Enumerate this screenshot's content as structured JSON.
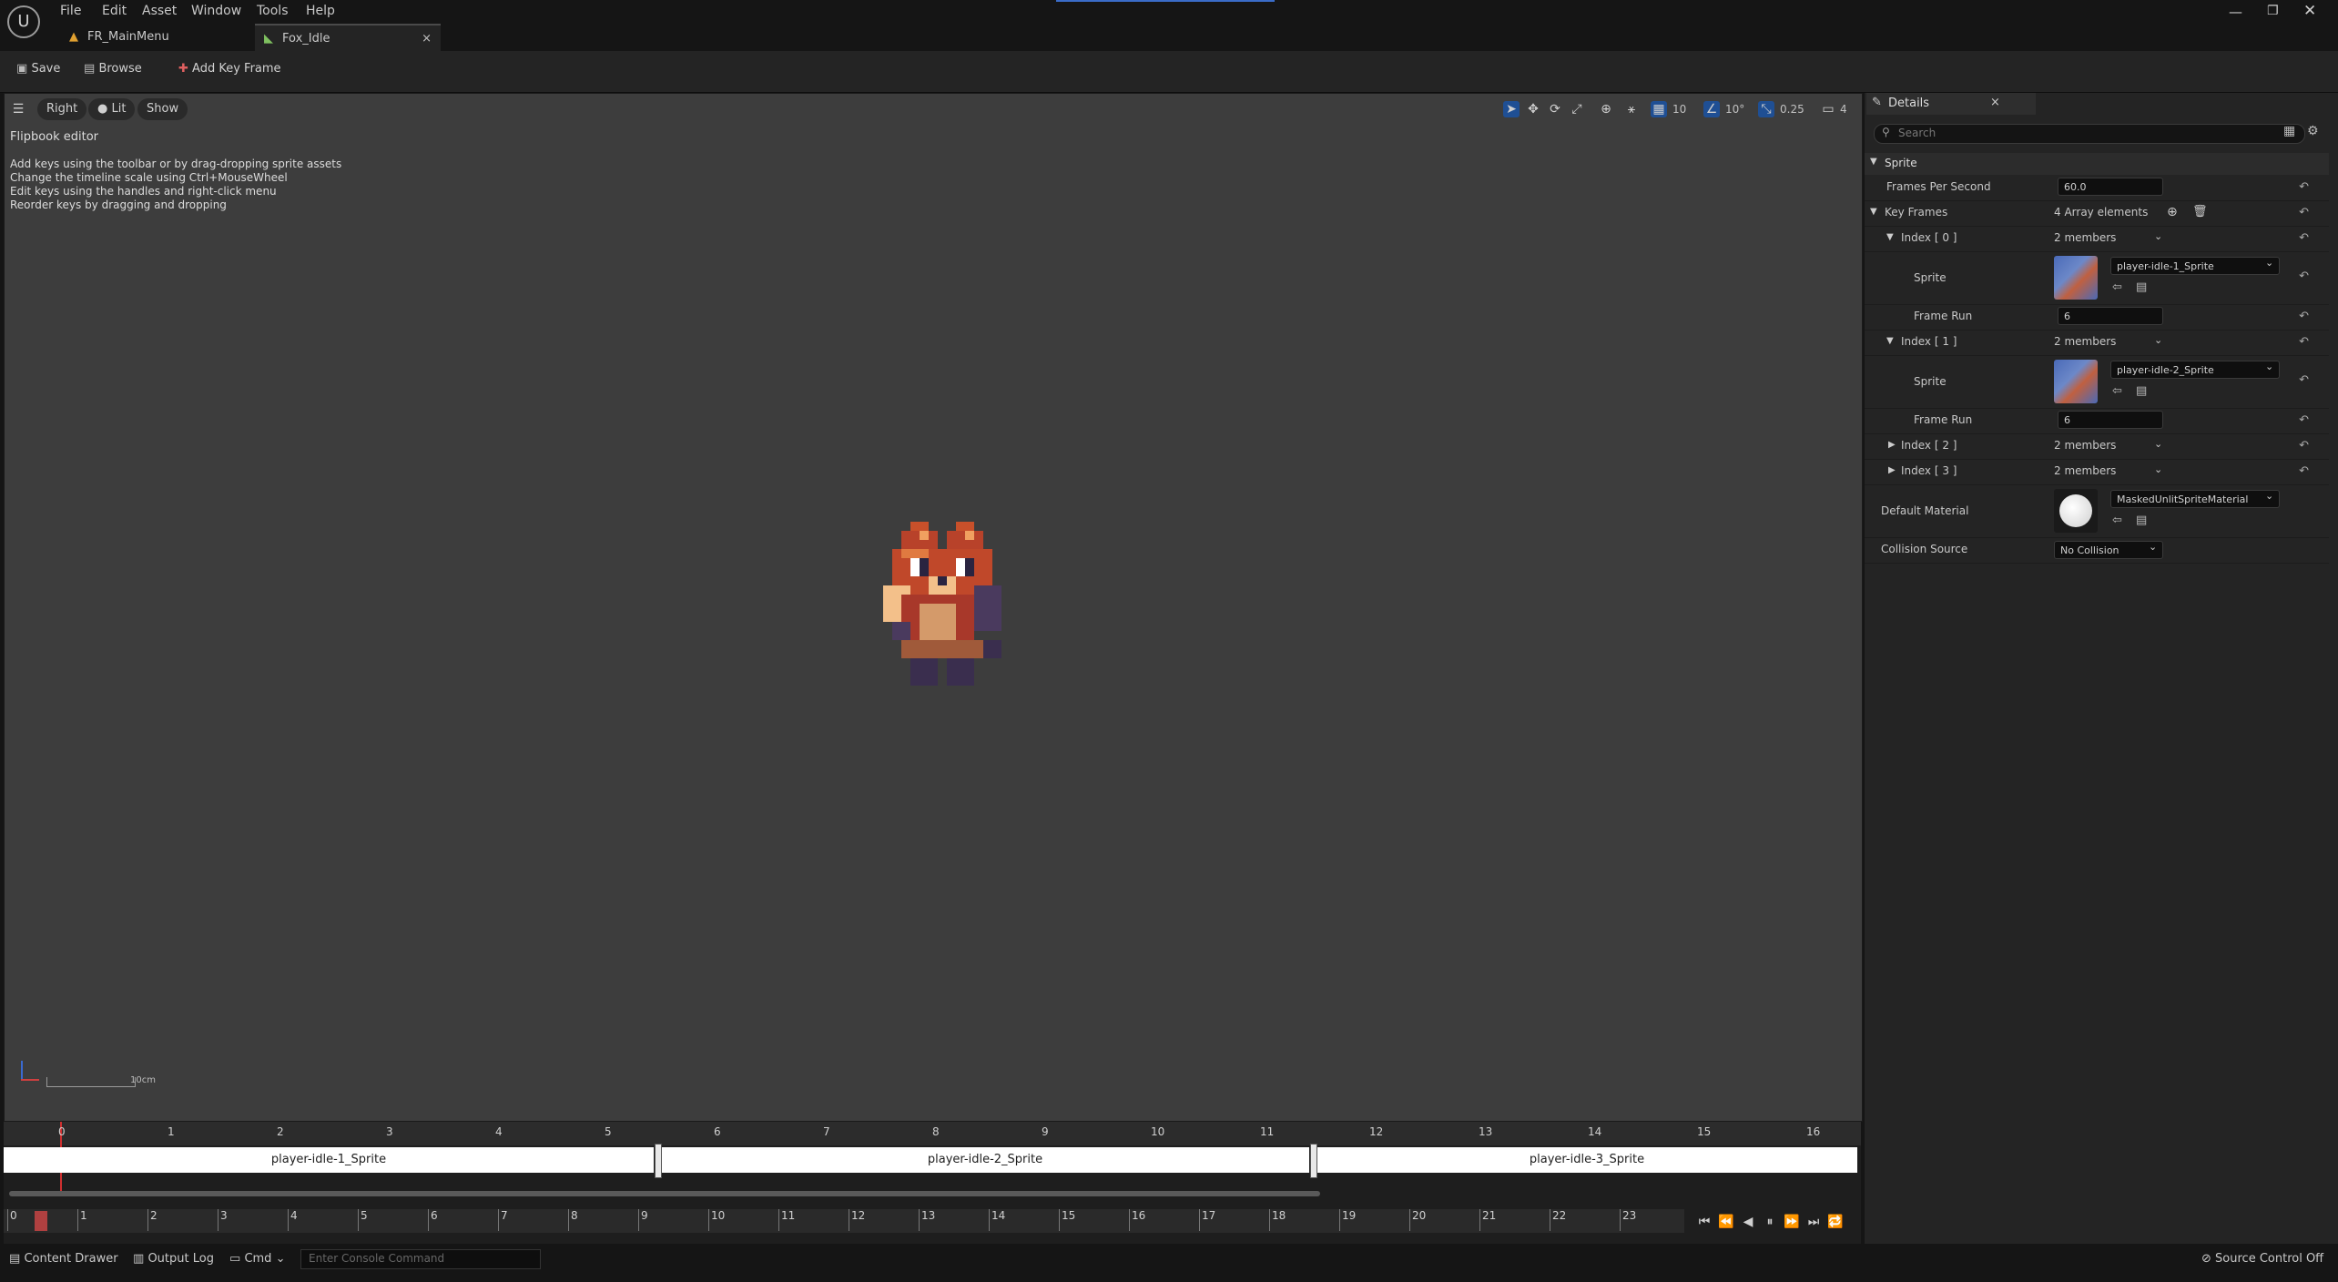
{
  "menu": [
    "File",
    "Edit",
    "Asset",
    "Window",
    "Tools",
    "Help"
  ],
  "tabs": [
    {
      "label": "FR_MainMenu"
    },
    {
      "label": "Fox_Idle"
    }
  ],
  "toolbar": {
    "save_label": "Save",
    "browse_label": "Browse",
    "add_key_frame_label": "Add Key Frame"
  },
  "viewport": {
    "view_mode": "Right",
    "lighting": "Lit",
    "show": "Show",
    "grid_snap": "10",
    "rotation_snap": "10°",
    "scale_snap": "0.25",
    "camera_speed": "4",
    "overlay_title": "Flipbook editor",
    "overlay_lines": [
      "Add keys using the toolbar or by drag-dropping sprite assets",
      "Change the timeline scale using Ctrl+MouseWheel",
      "Edit keys using the handles and right-click menu",
      "Reorder keys by dragging and dropping"
    ],
    "scale_label": "10cm"
  },
  "timeline": {
    "ruler": [
      "0",
      "1",
      "2",
      "3",
      "4",
      "5",
      "6",
      "7",
      "8",
      "9",
      "10",
      "11",
      "12",
      "13",
      "14",
      "15",
      "16"
    ],
    "keyframes": [
      "player-idle-1_Sprite",
      "player-idle-2_Sprite",
      "player-idle-3_Sprite"
    ],
    "scrubber": [
      "0",
      "1",
      "2",
      "3",
      "4",
      "5",
      "6",
      "7",
      "8",
      "9",
      "10",
      "11",
      "12",
      "13",
      "14",
      "15",
      "16",
      "17",
      "18",
      "19",
      "20",
      "21",
      "22",
      "23"
    ]
  },
  "details": {
    "title": "Details",
    "search_placeholder": "Search",
    "section": "Sprite",
    "fps_label": "Frames Per Second",
    "fps_value": "60.0",
    "keyframes_label": "Key Frames",
    "keyframes_value": "4 Array elements",
    "index0_label": "Index [ 0 ]",
    "index0_value": "2 members",
    "sprite_label": "Sprite",
    "sprite0_value": "player-idle-1_Sprite",
    "framerun_label": "Frame Run",
    "framerun0_value": "6",
    "index1_label": "Index [ 1 ]",
    "index1_value": "2 members",
    "sprite1_value": "player-idle-2_Sprite",
    "framerun1_value": "6",
    "index2_label": "Index [ 2 ]",
    "index2_value": "2 members",
    "index3_label": "Index [ 3 ]",
    "index3_value": "2 members",
    "material_label": "Default Material",
    "material_value": "MaskedUnlitSpriteMaterial",
    "collision_label": "Collision Source",
    "collision_value": "No Collision"
  },
  "status": {
    "content_drawer": "Content Drawer",
    "output_log": "Output Log",
    "cmd": "Cmd",
    "console_placeholder": "Enter Console Command",
    "source_control": "Source Control Off"
  }
}
